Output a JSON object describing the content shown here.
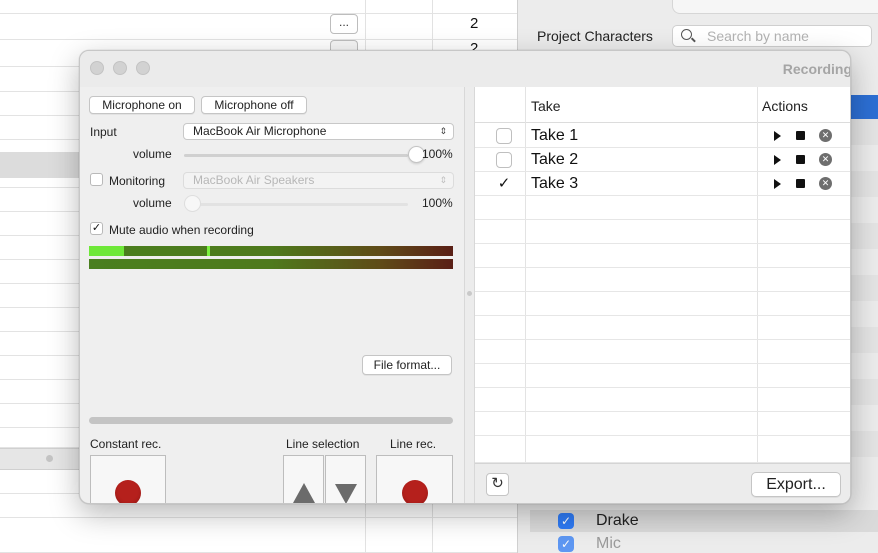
{
  "background": {
    "row_button": "...",
    "row_value_1": "2",
    "row_value_2": "2",
    "project_characters_label": "Project Characters",
    "search": {
      "placeholder": "Search by name",
      "value": ""
    },
    "characters": [
      {
        "name": "Drake",
        "checked": true,
        "check": "✓"
      },
      {
        "name": "Mic",
        "checked": true,
        "check": "✓"
      }
    ]
  },
  "window": {
    "title": "Recording",
    "mic_on_label": "Microphone on",
    "mic_off_label": "Microphone off",
    "input_label": "Input",
    "input_device": "MacBook Air Microphone",
    "input_volume_label": "volume",
    "input_volume_value": "100%",
    "input_volume_level": 1.0,
    "monitoring_label": "Monitoring",
    "monitoring_checked": false,
    "monitoring_device": "MacBook Air Speakers",
    "monitoring_volume_label": "volume",
    "monitoring_volume_value": "100%",
    "monitoring_volume_level": 0.0,
    "mute_label": "Mute audio when recording",
    "mute_checked": true,
    "mute_check": "✓",
    "meter_level": 0.095,
    "meter_peak": 0.325,
    "file_format_label": "File format...",
    "constant_rec_label": "Constant rec.",
    "line_selection_label": "Line selection",
    "line_rec_label": "Line rec.",
    "takes_table": {
      "columns": [
        "",
        "Take",
        "Actions"
      ],
      "rows": [
        {
          "name": "Take 1",
          "checked": false,
          "check": ""
        },
        {
          "name": "Take 2",
          "checked": false,
          "check": ""
        },
        {
          "name": "Take 3",
          "checked": true,
          "check": "✓"
        }
      ]
    },
    "refresh_icon": "↻",
    "export_label": "Export..."
  },
  "colors": {
    "accent_blue": "#2c6fd4",
    "checkbox_blue": "#2f7bf5",
    "record_red": "#b5201c",
    "meter_green": "#6ee838"
  }
}
